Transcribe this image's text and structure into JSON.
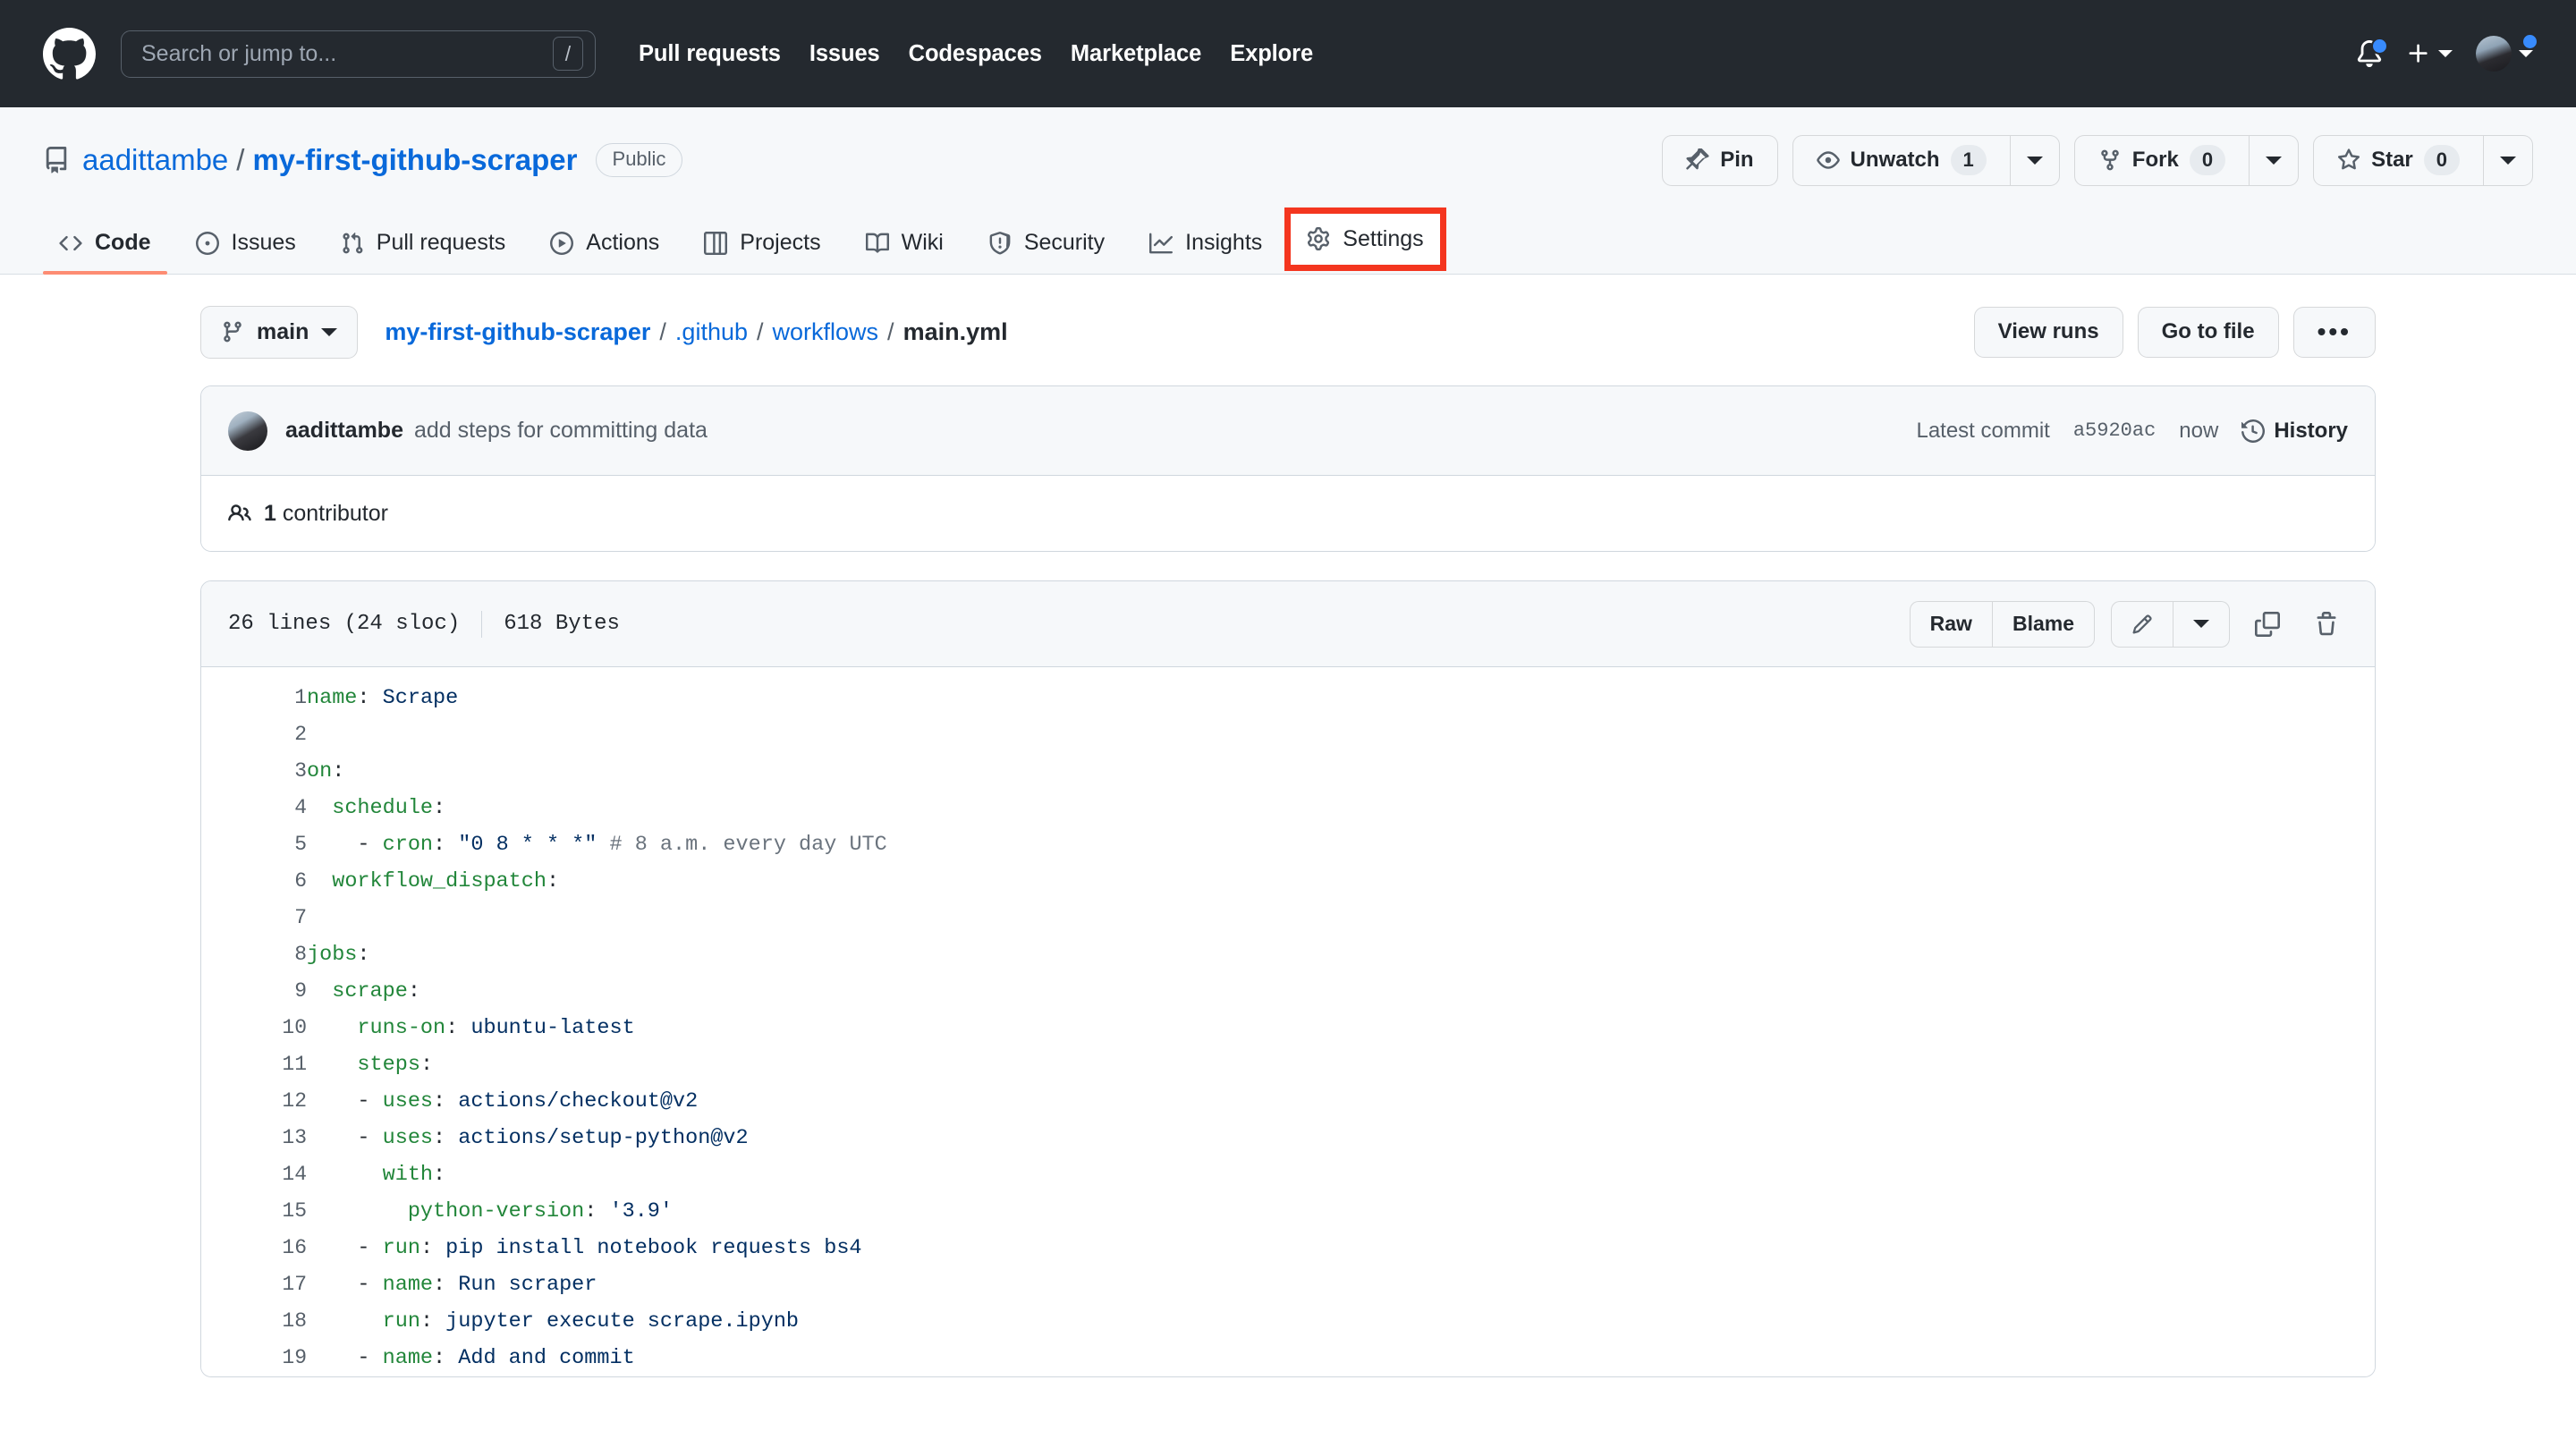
{
  "header": {
    "logo_icon": "github-mark-icon",
    "search": {
      "placeholder": "Search or jump to...",
      "value": "",
      "shortcut_key": "/"
    },
    "nav": [
      {
        "label": "Pull requests"
      },
      {
        "label": "Issues"
      },
      {
        "label": "Codespaces"
      },
      {
        "label": "Marketplace"
      },
      {
        "label": "Explore"
      }
    ],
    "notifications_icon": "bell-icon",
    "create_new_icon": "plus-icon",
    "account_icon": "avatar-icon"
  },
  "repo": {
    "icon": "repo-book-icon",
    "owner": "aadittambe",
    "separator": "/",
    "name": "my-first-github-scraper",
    "visibility": "Public",
    "actions": {
      "pin_label": "Pin",
      "watch_label": "Unwatch",
      "watch_count": "1",
      "fork_label": "Fork",
      "fork_count": "0",
      "star_label": "Star",
      "star_count": "0"
    }
  },
  "tabs": [
    {
      "label": "Code",
      "icon": "code-icon",
      "active": true,
      "highlighted": false
    },
    {
      "label": "Issues",
      "icon": "issue-icon",
      "active": false,
      "highlighted": false
    },
    {
      "label": "Pull requests",
      "icon": "git-pull-icon",
      "active": false,
      "highlighted": false
    },
    {
      "label": "Actions",
      "icon": "play-icon",
      "active": false,
      "highlighted": false
    },
    {
      "label": "Projects",
      "icon": "table-icon",
      "active": false,
      "highlighted": false
    },
    {
      "label": "Wiki",
      "icon": "book-icon",
      "active": false,
      "highlighted": false
    },
    {
      "label": "Security",
      "icon": "shield-icon",
      "active": false,
      "highlighted": false
    },
    {
      "label": "Insights",
      "icon": "graph-icon",
      "active": false,
      "highlighted": false
    },
    {
      "label": "Settings",
      "icon": "gear-icon",
      "active": false,
      "highlighted": true
    }
  ],
  "highlight_color": "#f4361f",
  "accent_color": "#0969da",
  "active_tab_underline": "#fd8c73",
  "file_nav": {
    "branch": "main",
    "breadcrumb": [
      {
        "text": "my-first-github-scraper",
        "type": "link-bold"
      },
      {
        "text": ".github",
        "type": "link"
      },
      {
        "text": "workflows",
        "type": "link"
      },
      {
        "text": "main.yml",
        "type": "current"
      }
    ],
    "view_runs_label": "View runs",
    "go_to_file_label": "Go to file",
    "more_label": "•••"
  },
  "commit": {
    "author": "aadittambe",
    "message": "add steps for committing data",
    "latest_prefix": "Latest commit",
    "sha": "a5920ac",
    "time": "now",
    "history_label": "History",
    "history_icon": "history-clock-icon",
    "contributors_icon": "people-icon",
    "contributors_count": "1",
    "contributors_label": "contributor"
  },
  "file": {
    "lines_text": "26 lines (24 sloc)",
    "size_text": "618 Bytes",
    "raw_label": "Raw",
    "blame_label": "Blame",
    "edit_icon": "pencil-icon",
    "edit_dropdown_icon": "chevron-down-icon",
    "copy_icon": "copy-icon",
    "delete_icon": "trash-icon"
  },
  "code": {
    "language": "yaml",
    "lines": [
      {
        "n": "1",
        "tokens": [
          {
            "t": "name",
            "c": "k"
          },
          {
            "t": ": ",
            "c": "p"
          },
          {
            "t": "Scrape",
            "c": "s"
          }
        ]
      },
      {
        "n": "2",
        "tokens": []
      },
      {
        "n": "3",
        "tokens": [
          {
            "t": "on",
            "c": "k"
          },
          {
            "t": ":",
            "c": "p"
          }
        ]
      },
      {
        "n": "4",
        "tokens": [
          {
            "t": "  ",
            "c": "p"
          },
          {
            "t": "schedule",
            "c": "k"
          },
          {
            "t": ":",
            "c": "p"
          }
        ]
      },
      {
        "n": "5",
        "tokens": [
          {
            "t": "    - ",
            "c": "p"
          },
          {
            "t": "cron",
            "c": "k"
          },
          {
            "t": ": ",
            "c": "p"
          },
          {
            "t": "\"0 8 * * *\"",
            "c": "s"
          },
          {
            "t": " # 8 a.m. every day UTC",
            "c": "c"
          }
        ]
      },
      {
        "n": "6",
        "tokens": [
          {
            "t": "  ",
            "c": "p"
          },
          {
            "t": "workflow_dispatch",
            "c": "k"
          },
          {
            "t": ":",
            "c": "p"
          }
        ]
      },
      {
        "n": "7",
        "tokens": []
      },
      {
        "n": "8",
        "tokens": [
          {
            "t": "jobs",
            "c": "k"
          },
          {
            "t": ":",
            "c": "p"
          }
        ]
      },
      {
        "n": "9",
        "tokens": [
          {
            "t": "  ",
            "c": "p"
          },
          {
            "t": "scrape",
            "c": "k"
          },
          {
            "t": ":",
            "c": "p"
          }
        ]
      },
      {
        "n": "10",
        "tokens": [
          {
            "t": "    ",
            "c": "p"
          },
          {
            "t": "runs-on",
            "c": "k"
          },
          {
            "t": ": ",
            "c": "p"
          },
          {
            "t": "ubuntu-latest",
            "c": "s"
          }
        ]
      },
      {
        "n": "11",
        "tokens": [
          {
            "t": "    ",
            "c": "p"
          },
          {
            "t": "steps",
            "c": "k"
          },
          {
            "t": ":",
            "c": "p"
          }
        ]
      },
      {
        "n": "12",
        "tokens": [
          {
            "t": "    - ",
            "c": "p"
          },
          {
            "t": "uses",
            "c": "k"
          },
          {
            "t": ": ",
            "c": "p"
          },
          {
            "t": "actions/checkout@v2",
            "c": "s"
          }
        ]
      },
      {
        "n": "13",
        "tokens": [
          {
            "t": "    - ",
            "c": "p"
          },
          {
            "t": "uses",
            "c": "k"
          },
          {
            "t": ": ",
            "c": "p"
          },
          {
            "t": "actions/setup-python@v2",
            "c": "s"
          }
        ]
      },
      {
        "n": "14",
        "tokens": [
          {
            "t": "      ",
            "c": "p"
          },
          {
            "t": "with",
            "c": "k"
          },
          {
            "t": ":",
            "c": "p"
          }
        ]
      },
      {
        "n": "15",
        "tokens": [
          {
            "t": "        ",
            "c": "p"
          },
          {
            "t": "python-version",
            "c": "k"
          },
          {
            "t": ": ",
            "c": "p"
          },
          {
            "t": "'3.9'",
            "c": "s"
          }
        ]
      },
      {
        "n": "16",
        "tokens": [
          {
            "t": "    - ",
            "c": "p"
          },
          {
            "t": "run",
            "c": "k"
          },
          {
            "t": ": ",
            "c": "p"
          },
          {
            "t": "pip install notebook requests bs4",
            "c": "s"
          }
        ]
      },
      {
        "n": "17",
        "tokens": [
          {
            "t": "    - ",
            "c": "p"
          },
          {
            "t": "name",
            "c": "k"
          },
          {
            "t": ": ",
            "c": "p"
          },
          {
            "t": "Run scraper",
            "c": "s"
          }
        ]
      },
      {
        "n": "18",
        "tokens": [
          {
            "t": "      ",
            "c": "p"
          },
          {
            "t": "run",
            "c": "k"
          },
          {
            "t": ": ",
            "c": "p"
          },
          {
            "t": "jupyter execute scrape.ipynb",
            "c": "s"
          }
        ]
      },
      {
        "n": "19",
        "tokens": [
          {
            "t": "    - ",
            "c": "p"
          },
          {
            "t": "name",
            "c": "k"
          },
          {
            "t": ": ",
            "c": "p"
          },
          {
            "t": "Add and commit",
            "c": "s"
          }
        ]
      }
    ]
  }
}
